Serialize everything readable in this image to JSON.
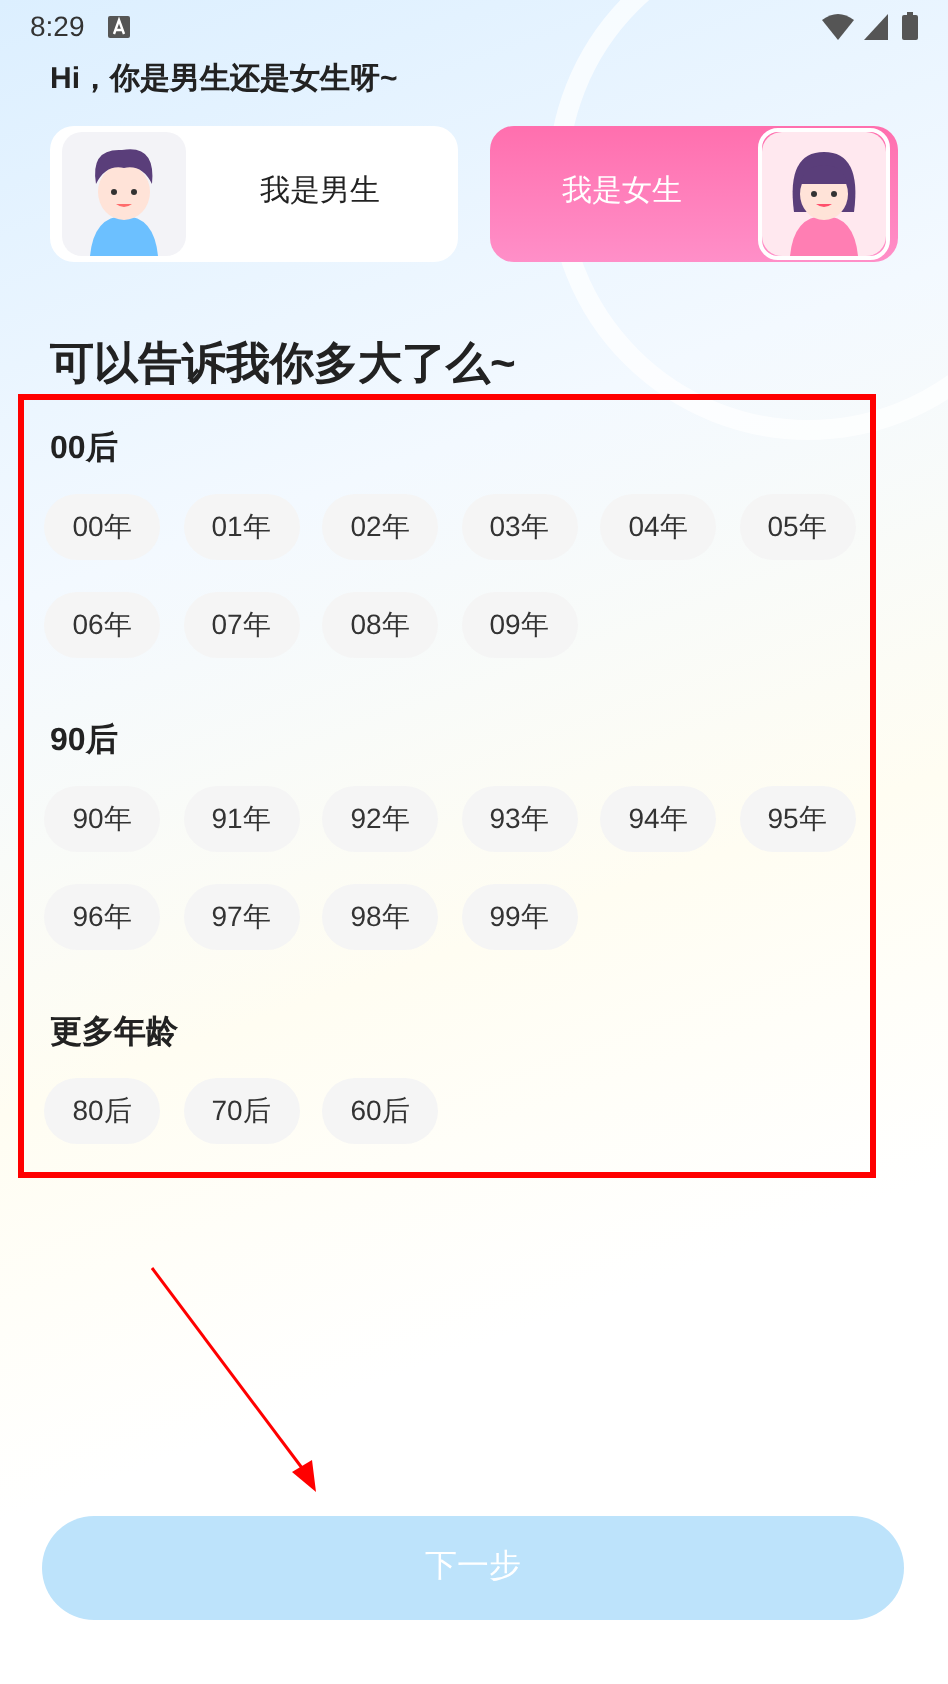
{
  "status_bar": {
    "time": "8:29"
  },
  "greeting": "Hi，你是男生还是女生呀~",
  "genders": [
    {
      "kind": "male",
      "label": "我是男生",
      "selected": false
    },
    {
      "kind": "female",
      "label": "我是女生",
      "selected": true
    }
  ],
  "age_heading": "可以告诉我你多大了么~",
  "age_groups": [
    {
      "title": "00后",
      "options": [
        {
          "label": "00年",
          "selected": false
        },
        {
          "label": "01年",
          "selected": false
        },
        {
          "label": "02年",
          "selected": false
        },
        {
          "label": "03年",
          "selected": false
        },
        {
          "label": "04年",
          "selected": false
        },
        {
          "label": "05年",
          "selected": false
        },
        {
          "label": "06年",
          "selected": false
        },
        {
          "label": "07年",
          "selected": false
        },
        {
          "label": "08年",
          "selected": false
        },
        {
          "label": "09年",
          "selected": false
        }
      ]
    },
    {
      "title": "90后",
      "options": [
        {
          "label": "90年",
          "selected": false
        },
        {
          "label": "91年",
          "selected": false
        },
        {
          "label": "92年",
          "selected": false
        },
        {
          "label": "93年",
          "selected": false
        },
        {
          "label": "94年",
          "selected": false
        },
        {
          "label": "95年",
          "selected": false
        },
        {
          "label": "96年",
          "selected": false
        },
        {
          "label": "97年",
          "selected": false
        },
        {
          "label": "98年",
          "selected": false
        },
        {
          "label": "99年",
          "selected": false
        }
      ]
    },
    {
      "title": "更多年龄",
      "options": [
        {
          "label": "80后",
          "selected": false
        },
        {
          "label": "70后",
          "selected": false
        },
        {
          "label": "60后",
          "selected": false
        }
      ]
    }
  ],
  "next_button": {
    "label": "下一步",
    "disabled": true
  }
}
